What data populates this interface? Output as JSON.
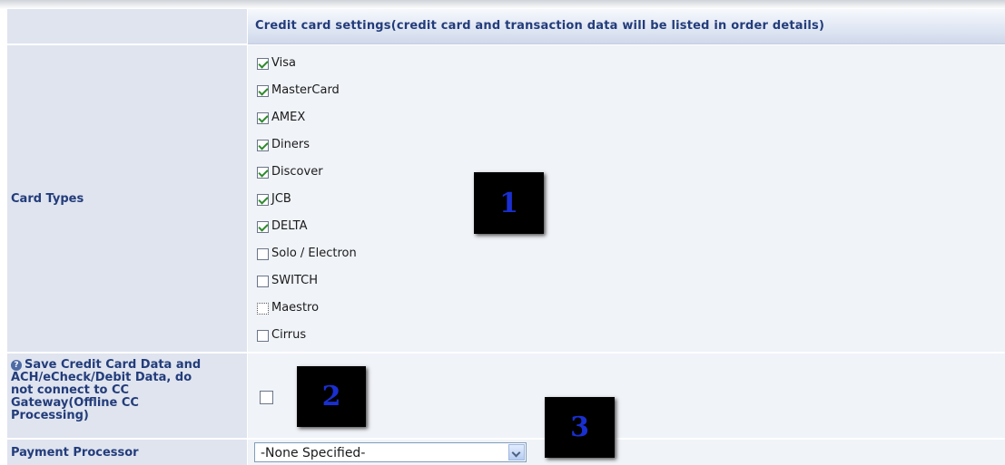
{
  "header": {
    "title": "Credit card settings(credit card and transaction data will be listed in order details)"
  },
  "card_types": {
    "label": "Card Types",
    "items": [
      {
        "label": "Visa",
        "checked": true
      },
      {
        "label": "MasterCard",
        "checked": true
      },
      {
        "label": "AMEX",
        "checked": true
      },
      {
        "label": "Diners",
        "checked": true
      },
      {
        "label": "Discover",
        "checked": true
      },
      {
        "label": "JCB",
        "checked": true
      },
      {
        "label": "DELTA",
        "checked": true
      },
      {
        "label": "Solo / Electron",
        "checked": false
      },
      {
        "label": "SWITCH",
        "checked": false
      },
      {
        "label": "Maestro",
        "checked": false
      },
      {
        "label": "Cirrus",
        "checked": false
      }
    ]
  },
  "save_offline": {
    "icon": "help-icon",
    "label_lines": [
      "Save Credit Card Data and",
      "ACH/eCheck/Debit Data, do",
      "not connect to CC",
      "Gateway(Offline CC",
      "Processing)"
    ],
    "checked": false
  },
  "payment_processor": {
    "label": "Payment Processor",
    "selected": "-None Specified-"
  },
  "badges": [
    "1",
    "2",
    "3"
  ]
}
